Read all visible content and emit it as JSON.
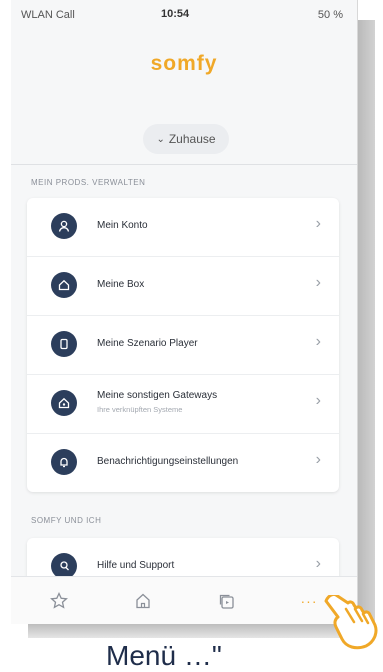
{
  "status_bar": {
    "carrier": "WLAN Call",
    "time": "10:54",
    "battery": "50 %"
  },
  "logo": "somfy",
  "home_selector": {
    "label": "Zuhause"
  },
  "section_manage": "MEIN PRODS. VERWALTEN",
  "manage_items": [
    {
      "label": "Mein Konto",
      "sub": "",
      "icon": "user-icon"
    },
    {
      "label": "Meine Box",
      "sub": "",
      "icon": "home-box-icon"
    },
    {
      "label": "Meine Szenario Player",
      "sub": "",
      "icon": "scenario-player-icon"
    },
    {
      "label": "Meine sonstigen Gateways",
      "sub": "Ihre verknüpften Systeme",
      "icon": "gateway-icon"
    },
    {
      "label": "Benachrichtigungseinstellungen",
      "sub": "",
      "icon": "bell-icon"
    }
  ],
  "section_somfy": "SOMFY UND ICH",
  "somfy_items": [
    {
      "label": "Hilfe und Support",
      "icon": "help-icon"
    }
  ],
  "tabbar": {
    "tabs": [
      "favorites-icon",
      "home-icon",
      "devices-icon",
      "more-icon"
    ],
    "more_glyph": "···",
    "accent": "#f0a828"
  },
  "caption": "Menü …\""
}
